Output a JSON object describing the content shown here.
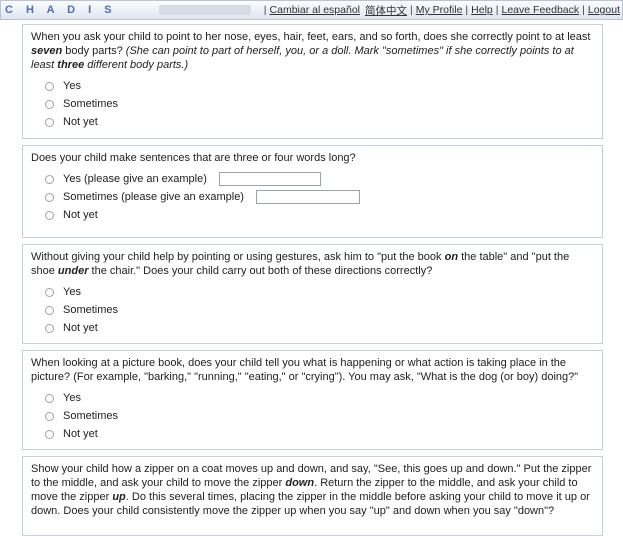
{
  "header": {
    "brand": "C H A D I S",
    "nav": [
      "Cambiar al español",
      "简体中文",
      "My Profile",
      "Help",
      "Leave Feedback",
      "Logout"
    ]
  },
  "options": [
    "Yes",
    "Sometimes",
    "Not yet"
  ],
  "q1": {
    "pre": "When you ask your child to point to her nose, eyes, hair, feet, ears, and so forth, does she correctly point to at least ",
    "em": "seven",
    "post": " body parts? ",
    "note_pre": "(She can point to part of herself, you, or a doll. Mark \"sometimes\" if she correctly points to at least ",
    "note_em": "three",
    "note_post": " different body parts.)"
  },
  "q2": {
    "text": "Does your child make sentences that are three or four words long?",
    "opt_yes": "Yes (please give an example)",
    "opt_sometimes": "Sometimes (please give an example)",
    "opt_notyet": "Not yet"
  },
  "q3": {
    "a": "Without giving your child help by pointing or using gestures, ask him to \"put the book ",
    "em1": "on",
    "b": " the table\" and \"put the shoe ",
    "em2": "under",
    "c": " the chair.\" Does your child carry out both of these directions correctly?"
  },
  "q4": {
    "text": "When looking at a picture book, does your child tell you what is happening or what action is taking place in the picture? (For example, \"barking,\" \"running,\" \"eating,\" or \"crying\"). You may ask, \"What is the dog (or boy) doing?\""
  },
  "q5": {
    "a": "Show your child how a zipper on a coat moves up and down, and say, \"See, this goes up and down.\" Put the zipper to the middle, and ask your child to move the zipper ",
    "em1": "down",
    "b": ". Return the zipper to the middle, and ask your child to move the zipper ",
    "em2": "up",
    "c": ". Do this several times, placing the zipper in the middle before asking your child to move it up or down. Does your child consistently move the zipper up when you say \"up\" and down when you say \"down\"?"
  }
}
